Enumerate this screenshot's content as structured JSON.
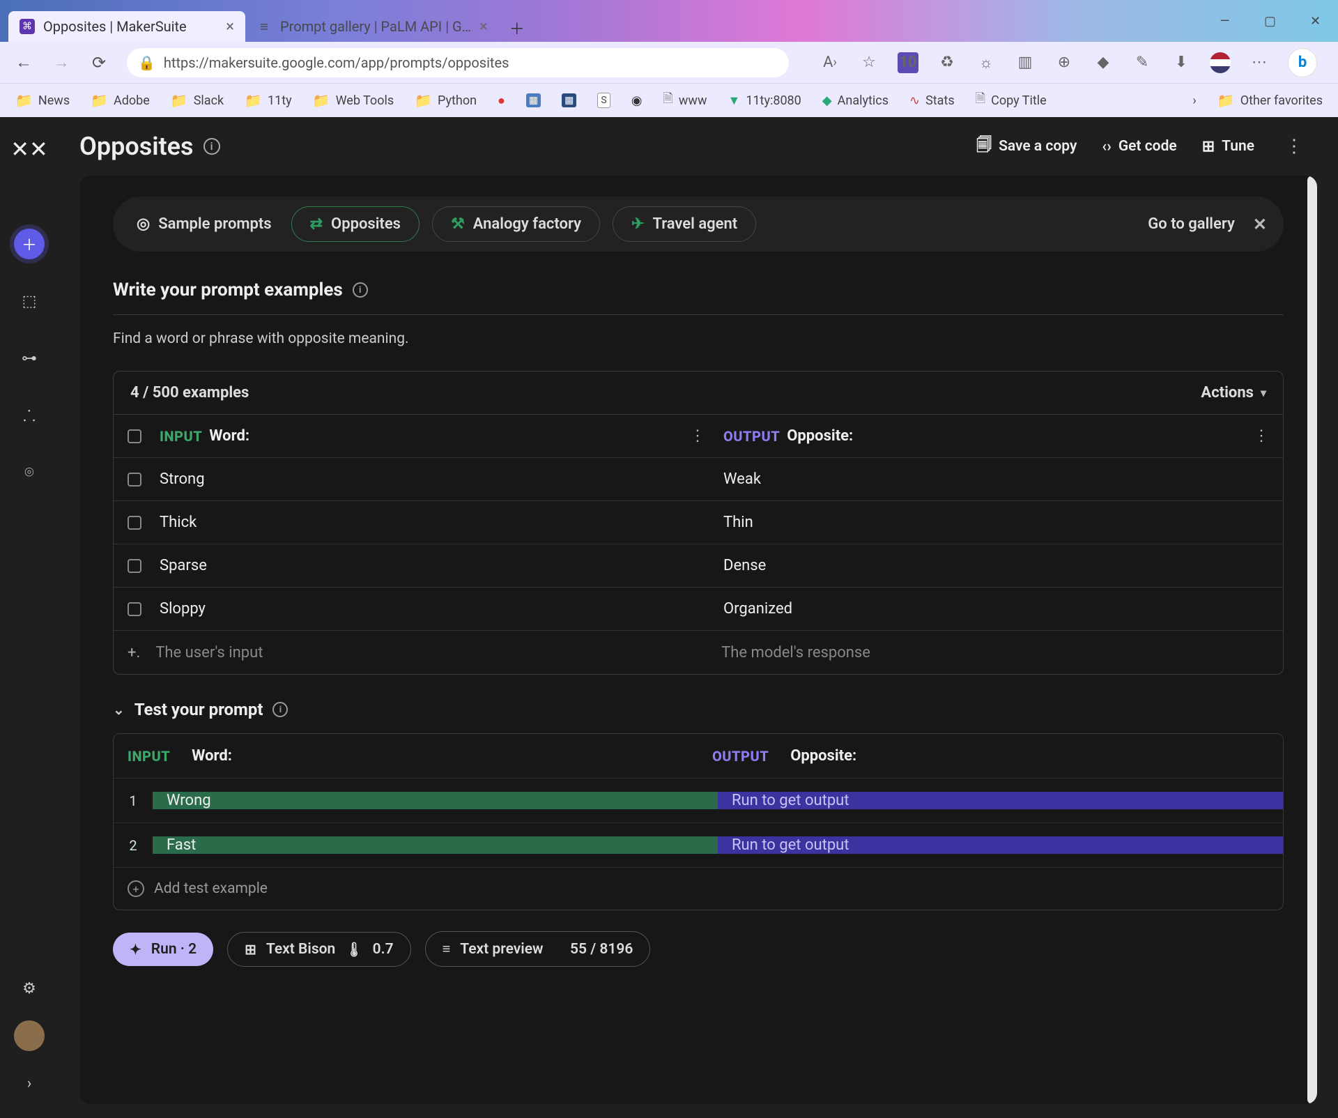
{
  "browser": {
    "tabs": [
      {
        "title": "Opposites | MakerSuite",
        "active": true
      },
      {
        "title": "Prompt gallery | PaLM API | G…",
        "active": false
      }
    ],
    "url": "https://makersuite.google.com/app/prompts/opposites",
    "addrIcons": {
      "calendar": "10"
    },
    "bookmarks": [
      {
        "label": "News",
        "type": "folder"
      },
      {
        "label": "Adobe",
        "type": "folder"
      },
      {
        "label": "Slack",
        "type": "folder"
      },
      {
        "label": "11ty",
        "type": "folder"
      },
      {
        "label": "Web Tools",
        "type": "folder"
      },
      {
        "label": "Python",
        "type": "folder"
      },
      {
        "label": "www",
        "type": "doc"
      },
      {
        "label": "11ty:8080",
        "type": "diamond"
      },
      {
        "label": "Analytics",
        "type": "diamond"
      },
      {
        "label": "Stats",
        "type": "squiggle"
      },
      {
        "label": "Copy Title",
        "type": "doc"
      }
    ],
    "otherFavorites": "Other favorites",
    "winButtons": {
      "min": "—",
      "max": "▢",
      "close": "✕"
    }
  },
  "page": {
    "title": "Opposites",
    "headerActions": {
      "save": "Save a copy",
      "code": "Get code",
      "tune": "Tune"
    },
    "samplePromptsLabel": "Sample prompts",
    "chips": [
      "Opposites",
      "Analogy factory",
      "Travel agent"
    ],
    "goToGallery": "Go to gallery",
    "sectionTitle": "Write your prompt examples",
    "description": "Find a word or phrase with opposite meaning.",
    "examples": {
      "count": "4 / 500 examples",
      "actions": "Actions",
      "inputTag": "INPUT",
      "outputTag": "OUTPUT",
      "inputHeader": "Word:",
      "outputHeader": "Opposite:",
      "rows": [
        {
          "in": "Strong",
          "out": "Weak"
        },
        {
          "in": "Thick",
          "out": "Thin"
        },
        {
          "in": "Sparse",
          "out": "Dense"
        },
        {
          "in": "Sloppy",
          "out": "Organized"
        }
      ],
      "ghostIn": "The user's input",
      "ghostOut": "The model's response"
    },
    "test": {
      "title": "Test your prompt",
      "inputTag": "INPUT",
      "outputTag": "OUTPUT",
      "inputHeader": "Word:",
      "outputHeader": "Opposite:",
      "rows": [
        {
          "n": "1",
          "in": "Wrong",
          "out": "Run to get output"
        },
        {
          "n": "2",
          "in": "Fast",
          "out": "Run to get output"
        }
      ],
      "add": "Add test example"
    },
    "footer": {
      "run": "Run · 2",
      "model": "Text Bison",
      "temp": "0.7",
      "preview": "Text preview",
      "tokens": "55 / 8196"
    }
  }
}
